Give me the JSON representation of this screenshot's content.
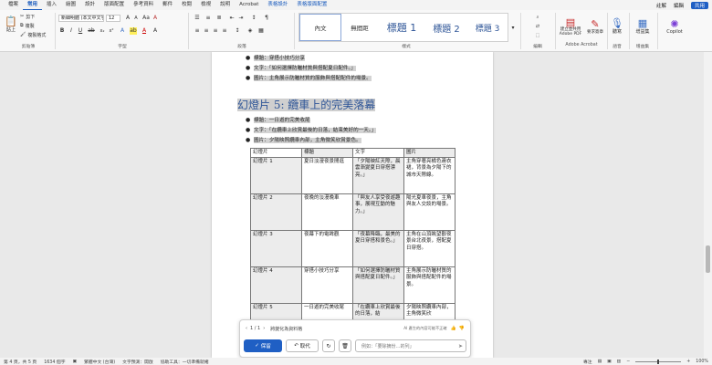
{
  "tabs": [
    "檔案",
    "常用",
    "插入",
    "繪圖",
    "設計",
    "版面配置",
    "參考資料",
    "郵件",
    "校閱",
    "檢視",
    "說明",
    "Acrobat",
    "表格設計",
    "表格版面配置"
  ],
  "active_tab_index": 1,
  "tabs_right": {
    "comments": "註解",
    "edit": "編輯",
    "share": "共用"
  },
  "ribbon": {
    "clipboard": {
      "paste": "貼上",
      "cut": "剪下",
      "copy": "複製",
      "format_painter": "複製格式",
      "label": "剪貼簿"
    },
    "font": {
      "name": "新細明體 (本文中文字)",
      "size": "12",
      "label": "字型"
    },
    "paragraph": {
      "label": "段落"
    },
    "styles": {
      "items": [
        "內文",
        "無間距",
        "標題 1",
        "標題 2",
        "標題 3"
      ],
      "selected_index": 0,
      "label": "樣式"
    },
    "editing": {
      "label": "編輯"
    },
    "acrobat": {
      "create_pdf": "建立並共用 Adobe PDF",
      "request_sig": "要求簽章",
      "label": "Adobe Acrobat"
    },
    "voice": {
      "dictate": "聽寫",
      "label": "語音"
    },
    "addins": {
      "addins": "增益集",
      "label": "增益集"
    },
    "copilot": {
      "label": "Copilot"
    }
  },
  "doc": {
    "bullets_top": [
      {
        "label": "標題",
        "text": "穿搭小技巧分享"
      },
      {
        "label": "文字",
        "text": "「如何選擇防曬材質與搭配夏日配件。」"
      },
      {
        "label": "圖片",
        "text": "主角展示防曬材質的服飾與搭配配件的場景。"
      }
    ],
    "heading": "幻燈片 5: 纜車上的完美落幕",
    "bullets_mid": [
      {
        "label": "標題",
        "text": "一日遊的完美收尾"
      },
      {
        "label": "文字",
        "text": "「在纜車上欣賞最後的日落，結束美好的一天。」"
      },
      {
        "label": "圖片",
        "text": "夕陽映照纜車內部，主角微笑欣賞景色。"
      }
    ],
    "table": {
      "headers": [
        "幻燈片",
        "標題",
        "文字",
        "圖片"
      ],
      "rows": [
        [
          "幻燈片 1",
          "夏日淡漫夜景閒逛",
          "「夕陽映紅天際，晨雲漸變夏日穿搭漂亮。」",
          "主角穿著亮橘色連衣裙，背景為夕陽下的城市天際線。"
        ],
        [
          "幻燈片 2",
          "夜晚的淡漫晚車",
          "「與友人享受夜遊趣事，展現互動的魅力。」",
          "陽光夏車夜景，主角與友人交談的場景。"
        ],
        [
          "幻燈片 3",
          "夜幕下的電眸觀",
          "「夜幕降臨，最美的夏日穿搭和景色。」",
          "主角在山頂眺望觀夜景台北夜景，搭配夏日穿搭。"
        ],
        [
          "幻燈片 4",
          "穿搭小技巧分享",
          "「如何選擇防曬材質與搭配夏日配件。」",
          "主角展示防曬材質的服飾與搭配配件的場景。"
        ],
        [
          "幻燈片 5",
          "一日遊的完美收尾",
          "「在纜車上欣賞最後的日落，結",
          "夕陽映照纜車內部，主角微笑欣"
        ]
      ]
    }
  },
  "copilot_card": {
    "pager": "1 / 1",
    "summary": "將變化為資料格",
    "ai_note": "AI 產生的內容可能不正確",
    "keep": "保留",
    "undo": "取代",
    "prompt_placeholder": "例如：「要除摘份…的列」"
  },
  "status": {
    "page": "第 4 頁，共 5 頁",
    "words": "1634 個字",
    "lang": "繁體中文 (台灣)",
    "predict": "文字預測：開啟",
    "access": "協助工具：一切準備就緒",
    "focus": "專注",
    "zoom": "100%"
  }
}
